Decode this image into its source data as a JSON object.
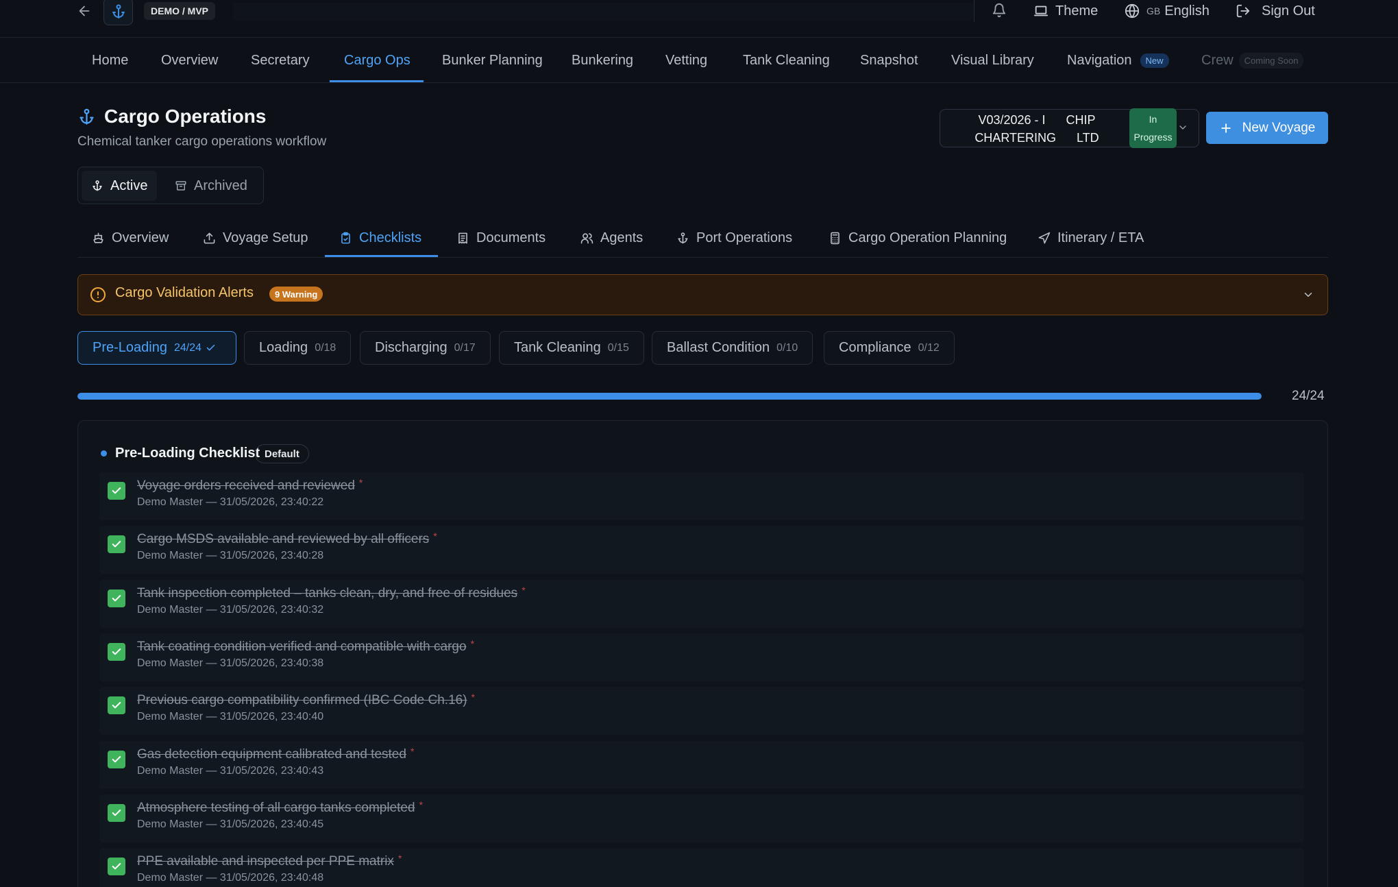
{
  "topbar": {
    "env_badge": "DEMO / MVP",
    "theme_label": "Theme",
    "language_flag": "GB",
    "language_label": "English",
    "signout_label": "Sign Out"
  },
  "nav": {
    "items": [
      "Home",
      "Overview",
      "Secretary",
      "Cargo Ops",
      "Bunker Planning",
      "Bunkering",
      "Vetting",
      "Tank Cleaning",
      "Snapshot",
      "Visual Library",
      "Navigation"
    ],
    "active": "Cargo Ops",
    "new_badge": "New",
    "crew_label": "Crew",
    "coming_soon": "Coming Soon"
  },
  "header": {
    "title": "Cargo Operations",
    "subtitle": "Chemical tanker cargo operations workflow",
    "voyage_line1": "V03/2026 - I      CHIP",
    "voyage_line2": "CHARTERING      LTD",
    "status_line1": "In",
    "status_line2": "Progress",
    "new_voyage_label": "New Voyage"
  },
  "segment": {
    "active_label": "Active",
    "archived_label": "Archived"
  },
  "subtabs": [
    "Overview",
    "Voyage Setup",
    "Checklists",
    "Documents",
    "Agents",
    "Port Operations",
    "Cargo Operation Planning",
    "Itinerary / ETA"
  ],
  "alerts": {
    "title": "Cargo Validation Alerts",
    "badge": "9 Warning"
  },
  "categories": [
    {
      "label": "Pre-Loading",
      "count": "24/24"
    },
    {
      "label": "Loading",
      "count": "0/18"
    },
    {
      "label": "Discharging",
      "count": "0/17"
    },
    {
      "label": "Tank Cleaning",
      "count": "0/15"
    },
    {
      "label": "Ballast Condition",
      "count": "0/10"
    },
    {
      "label": "Compliance",
      "count": "0/12"
    }
  ],
  "progress": {
    "value": 1.0,
    "label": "24/24"
  },
  "checklist": {
    "title": "Pre-Loading Checklist",
    "badge": "Default",
    "required_mark": "*",
    "items": [
      {
        "title": "Voyage orders received and reviewed",
        "meta": "Demo Master — 31/05/2026, 23:40:22"
      },
      {
        "title": "Cargo MSDS available and reviewed by all officers",
        "meta": "Demo Master — 31/05/2026, 23:40:28"
      },
      {
        "title": "Tank inspection completed – tanks clean, dry, and free of residues",
        "meta": "Demo Master — 31/05/2026, 23:40:32"
      },
      {
        "title": "Tank coating condition verified and compatible with cargo",
        "meta": "Demo Master — 31/05/2026, 23:40:38"
      },
      {
        "title": "Previous cargo compatibility confirmed (IBC Code Ch.16)",
        "meta": "Demo Master — 31/05/2026, 23:40:40"
      },
      {
        "title": "Gas detection equipment calibrated and tested",
        "meta": "Demo Master — 31/05/2026, 23:40:43"
      },
      {
        "title": "Atmosphere testing of all cargo tanks completed",
        "meta": "Demo Master — 31/05/2026, 23:40:45"
      },
      {
        "title": "PPE available and inspected per PPE matrix",
        "meta": "Demo Master — 31/05/2026, 23:40:48"
      }
    ]
  },
  "colors": {
    "accent": "#3d8ee8",
    "success": "#3fb45c",
    "warning": "#c7741f",
    "background": "#0d1117"
  }
}
